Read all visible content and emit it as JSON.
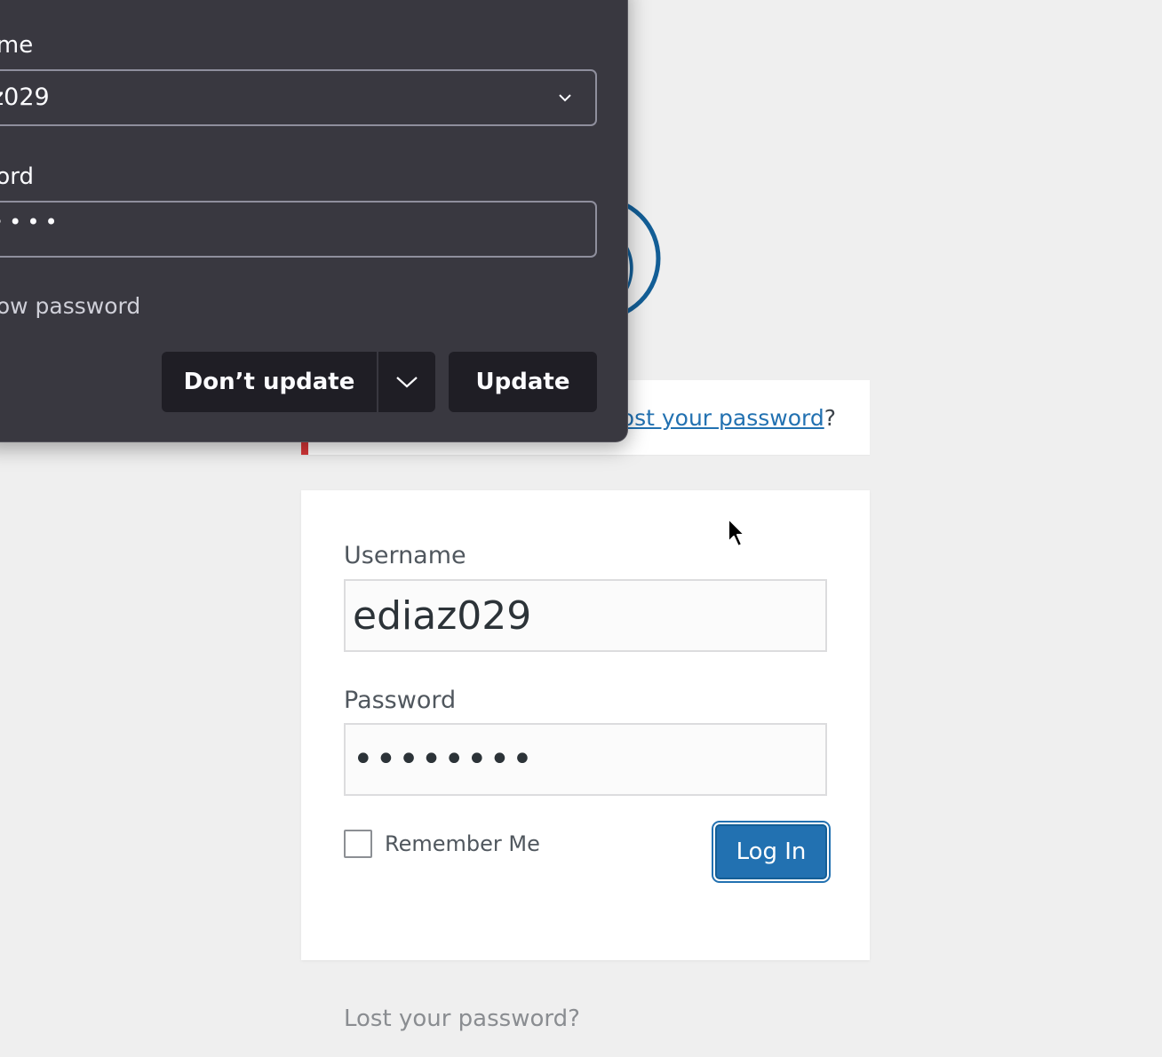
{
  "popup": {
    "username_label": "ame",
    "username_value": "z029",
    "password_label": "vord",
    "password_dots": "••••",
    "show_password": "how password",
    "dont_update_label": "Don’t update",
    "update_label": "Update"
  },
  "notice": {
    "link_text": "ost your password",
    "suffix": "?"
  },
  "login": {
    "username_label": "Username",
    "username_value": "ediaz029",
    "password_label": "Password",
    "password_value": "ediaz029",
    "remember_label": "Remember Me",
    "login_button": "Log In"
  },
  "footer": {
    "lost_password": "Lost your password?"
  },
  "colors": {
    "accent": "#2271b1",
    "error": "#d63638",
    "popup_bg": "#393840"
  }
}
